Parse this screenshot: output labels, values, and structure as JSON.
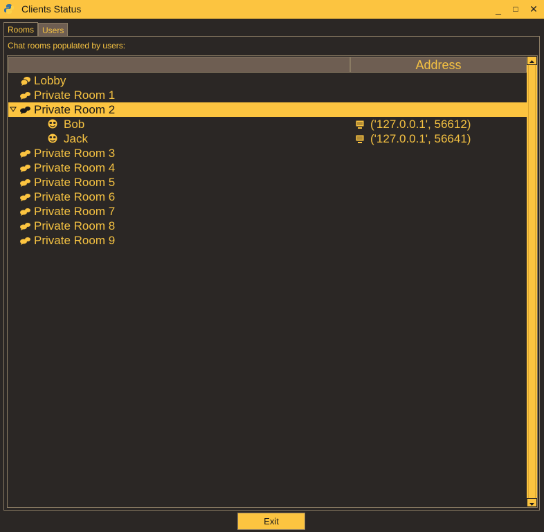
{
  "window": {
    "title": "Clients Status",
    "minimize": "_",
    "maximize": "□",
    "close": "✕"
  },
  "tabs": [
    {
      "label": "Rooms",
      "active": true
    },
    {
      "label": "Users",
      "active": false
    }
  ],
  "caption": "Chat rooms populated by users:",
  "columns": [
    "",
    "Address"
  ],
  "rooms": [
    {
      "name": "Lobby",
      "icon": "group-chat-icon"
    },
    {
      "name": "Private Room 1",
      "icon": "private-chat-icon"
    },
    {
      "name": "Private Room 2",
      "icon": "private-chat-icon",
      "expanded": true,
      "selected": true,
      "users": [
        {
          "name": "Bob",
          "address": "('127.0.0.1', 56612)"
        },
        {
          "name": "Jack",
          "address": "('127.0.0.1', 56641)"
        }
      ]
    },
    {
      "name": "Private Room 3",
      "icon": "private-chat-icon"
    },
    {
      "name": "Private Room 4",
      "icon": "private-chat-icon"
    },
    {
      "name": "Private Room 5",
      "icon": "private-chat-icon"
    },
    {
      "name": "Private Room 6",
      "icon": "private-chat-icon"
    },
    {
      "name": "Private Room 7",
      "icon": "private-chat-icon"
    },
    {
      "name": "Private Room 8",
      "icon": "private-chat-icon"
    },
    {
      "name": "Private Room 9",
      "icon": "private-chat-icon"
    }
  ],
  "exit_label": "Exit",
  "colors": {
    "accent": "#fcc440",
    "background": "#2b2725",
    "header": "#6e5e52",
    "text": "#f5c242"
  }
}
